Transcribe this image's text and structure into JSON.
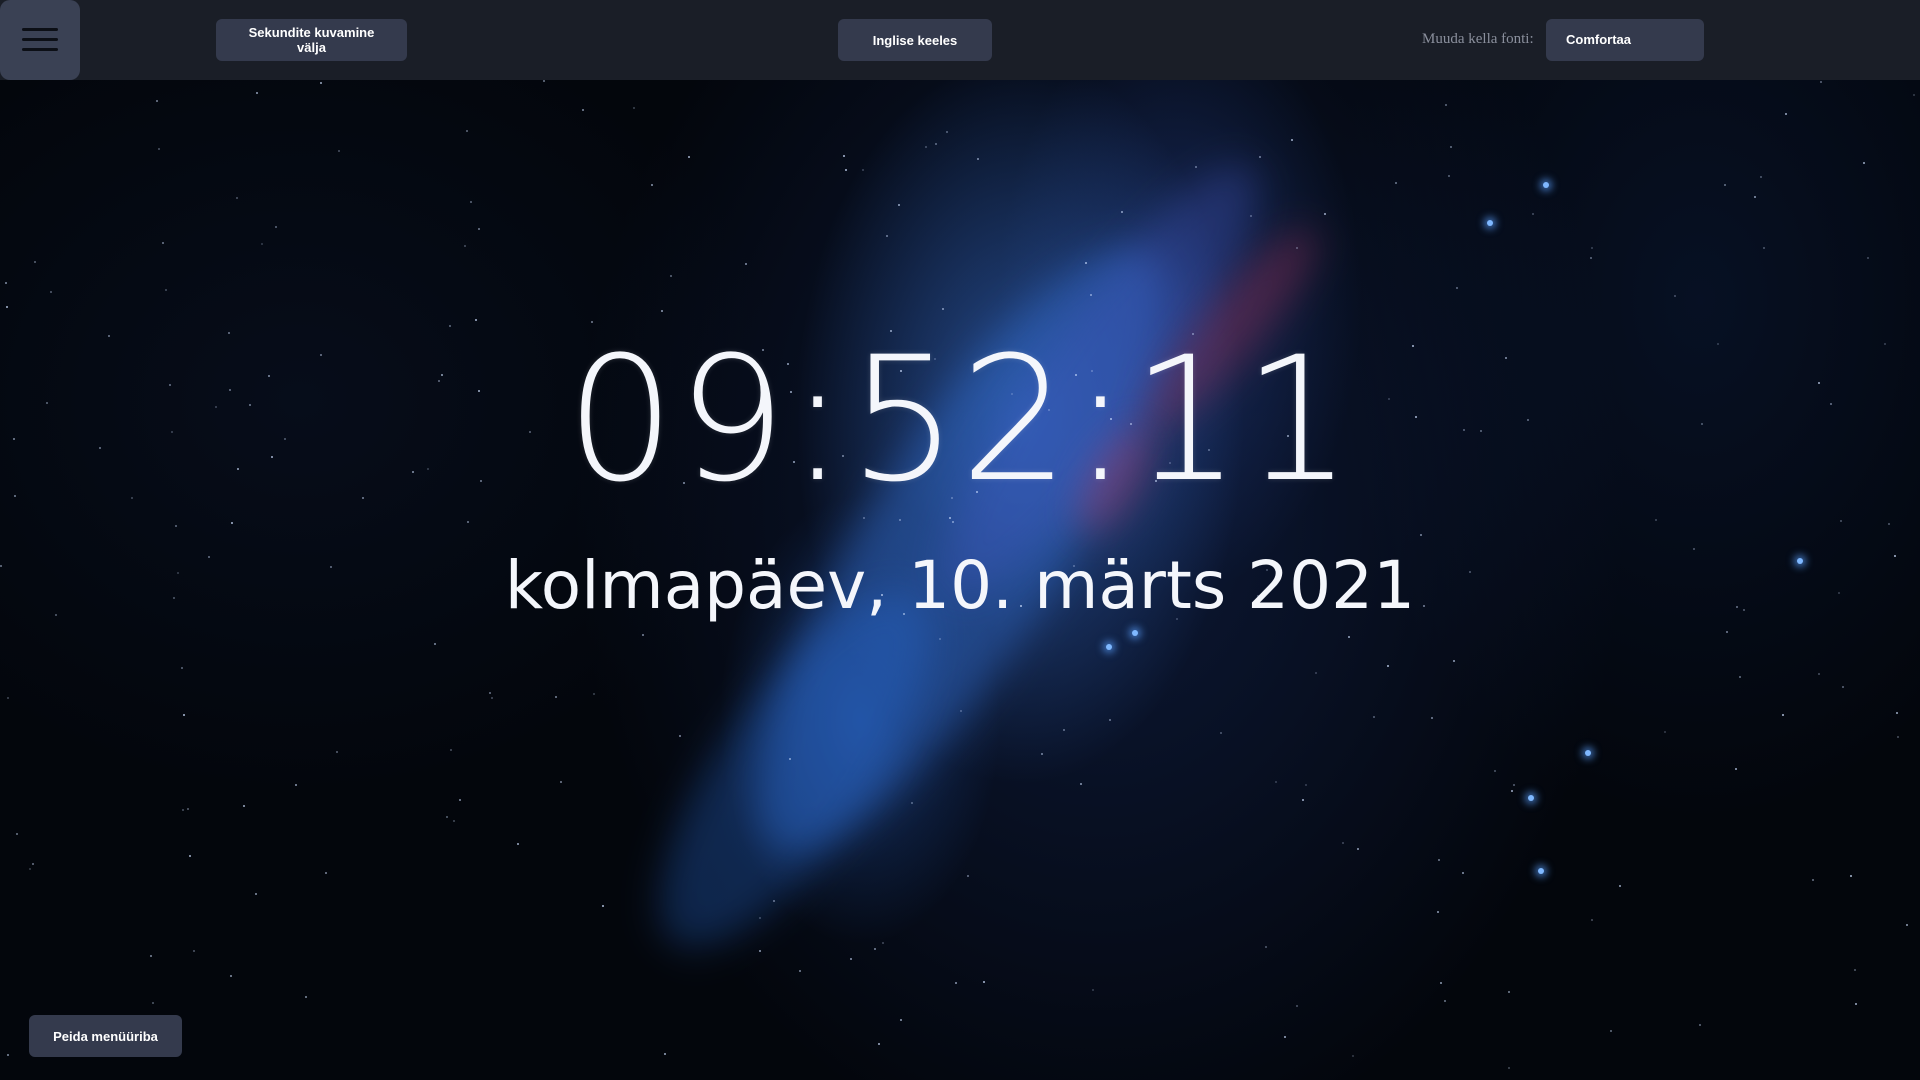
{
  "topbar": {
    "menu_icon": "hamburger-menu-icon",
    "seconds_toggle_label": "Sekundite kuvamine välja",
    "language_label": "Inglise keeles",
    "font_label": "Muuda kella fonti:",
    "font_selected": "Comfortaa"
  },
  "clock": {
    "time": "09:52:11",
    "date": "kolmapäev, 10. märts 2021"
  },
  "footer": {
    "hide_menu_label": "Peida menüüriba"
  },
  "colors": {
    "topbar_bg": "#1a1e27",
    "button_bg": "#343a4d",
    "text": "#f4f6fb"
  }
}
